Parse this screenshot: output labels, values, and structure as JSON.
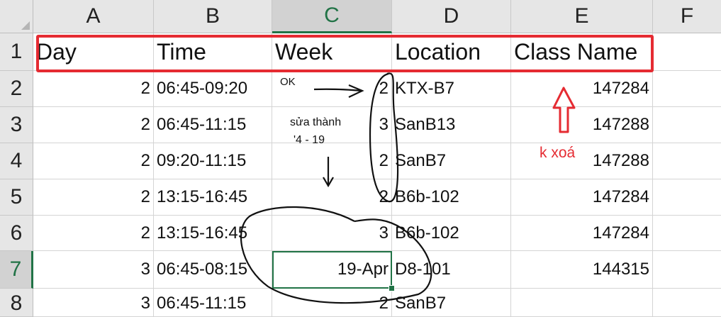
{
  "columns": [
    "A",
    "B",
    "C",
    "D",
    "E",
    "F"
  ],
  "selected_column": "C",
  "rows": [
    "1",
    "2",
    "3",
    "4",
    "5",
    "6",
    "7",
    "8"
  ],
  "selected_row": "7",
  "header": {
    "day": "Day",
    "time": "Time",
    "week": "Week",
    "location": "Location",
    "class_name": "Class Name"
  },
  "data": [
    {
      "day": "2",
      "time": "06:45-09:20",
      "week": "",
      "code": "2",
      "location": "KTX-B7",
      "class": "147284"
    },
    {
      "day": "2",
      "time": "06:45-11:15",
      "week": "",
      "code": "3",
      "location": "SanB13",
      "class": "147288"
    },
    {
      "day": "2",
      "time": "09:20-11:15",
      "week": "",
      "code": "2",
      "location": "SanB7",
      "class": "147288"
    },
    {
      "day": "2",
      "time": "13:15-16:45",
      "week": "",
      "code": "2",
      "location": "B6b-102",
      "class": "147284"
    },
    {
      "day": "2",
      "time": "13:15-16:45",
      "week": "",
      "code": "3",
      "location": "B6b-102",
      "class": "147284"
    },
    {
      "day": "3",
      "time": "06:45-08:15",
      "week": "19-Apr",
      "code": "",
      "location": "D8-101",
      "class": "144315"
    },
    {
      "day": "3",
      "time": "06:45-11:15",
      "week": "",
      "code": "2",
      "location": "SanB7",
      "class": ""
    }
  ],
  "annotations": {
    "ok": "OK",
    "fix_line1": "sửa thành",
    "fix_line2": "'4 - 19",
    "keep": "k xoá"
  },
  "colors": {
    "accent": "#217346",
    "annotation_red": "#e52b32",
    "ink": "#111111"
  }
}
